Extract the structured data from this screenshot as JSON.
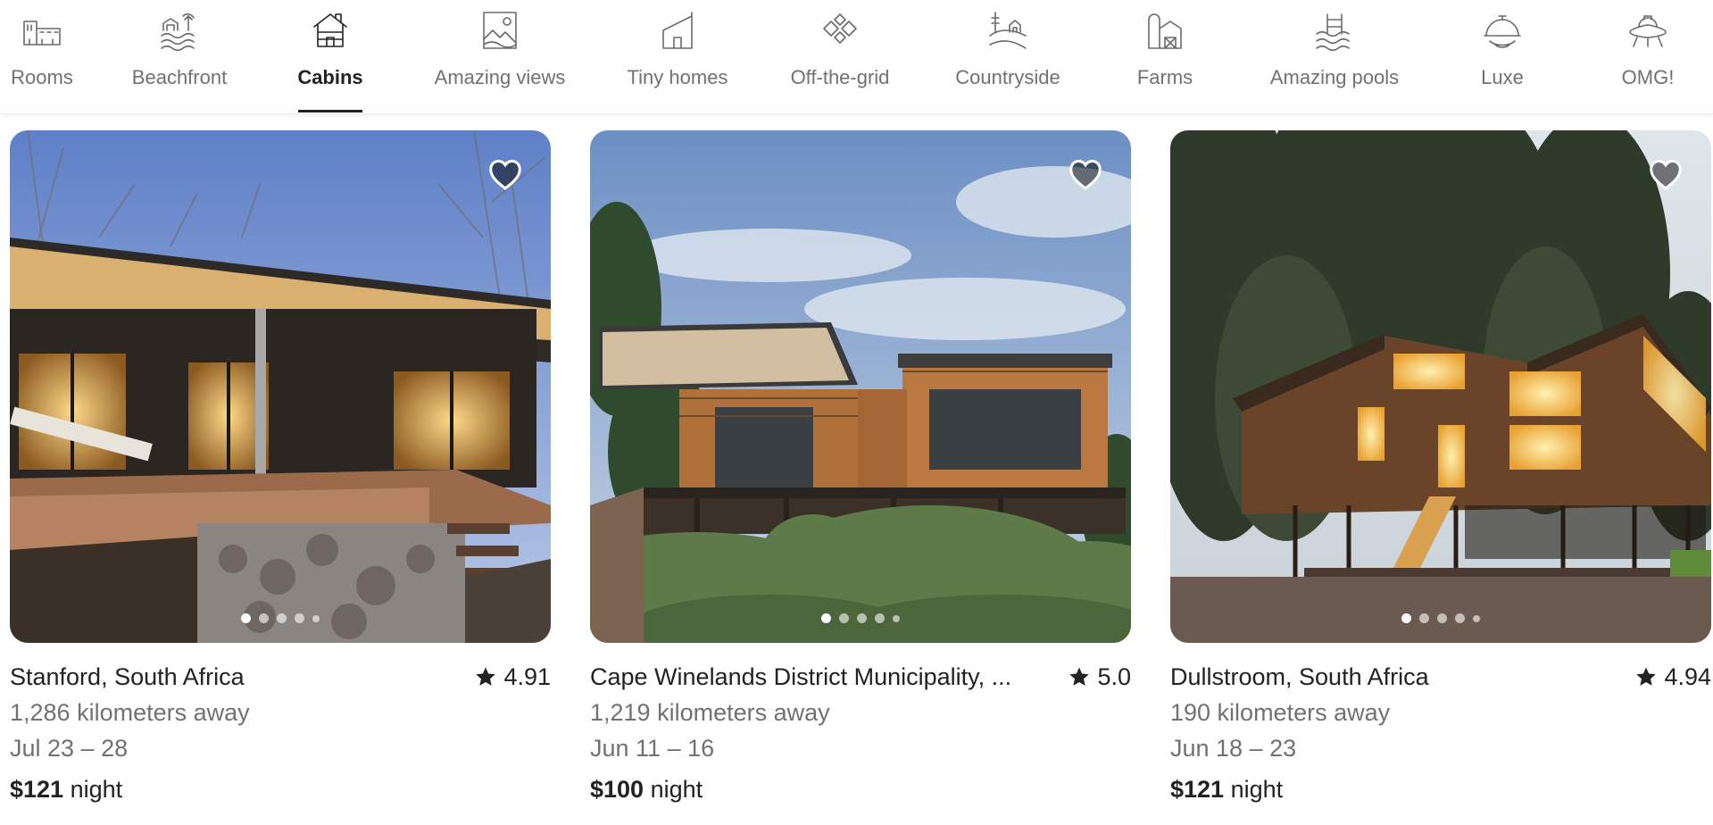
{
  "categories": [
    {
      "label": "Rooms",
      "icon": "rooms-icon",
      "active": false
    },
    {
      "label": "Beachfront",
      "icon": "beachfront-icon",
      "active": false
    },
    {
      "label": "Cabins",
      "icon": "cabins-icon",
      "active": true
    },
    {
      "label": "Amazing views",
      "icon": "amazing-views-icon",
      "active": false
    },
    {
      "label": "Tiny homes",
      "icon": "tiny-homes-icon",
      "active": false
    },
    {
      "label": "Off-the-grid",
      "icon": "off-the-grid-icon",
      "active": false
    },
    {
      "label": "Countryside",
      "icon": "countryside-icon",
      "active": false
    },
    {
      "label": "Farms",
      "icon": "farms-icon",
      "active": false
    },
    {
      "label": "Amazing pools",
      "icon": "amazing-pools-icon",
      "active": false
    },
    {
      "label": "Luxe",
      "icon": "luxe-icon",
      "active": false
    },
    {
      "label": "OMG!",
      "icon": "omg-icon",
      "active": false
    }
  ],
  "listings": [
    {
      "location": "Stanford, South Africa",
      "rating": "4.91",
      "distance": "1,286 kilometers away",
      "dates": "Jul 23 – 28",
      "price": "$121",
      "price_unit": "night",
      "photo_count": 5,
      "active_photo": 0
    },
    {
      "location": "Cape Winelands District Municipality, ...",
      "rating": "5.0",
      "distance": "1,219 kilometers away",
      "dates": "Jun 11 – 16",
      "price": "$100",
      "price_unit": "night",
      "photo_count": 5,
      "active_photo": 0
    },
    {
      "location": "Dullstroom, South Africa",
      "rating": "4.94",
      "distance": "190 kilometers away",
      "dates": "Jun 18 – 23",
      "price": "$121",
      "price_unit": "night",
      "photo_count": 5,
      "active_photo": 0
    }
  ],
  "colors": {
    "text_primary": "#222222",
    "text_secondary": "#717171",
    "heart_fill": "rgba(0,0,0,0.5)"
  }
}
